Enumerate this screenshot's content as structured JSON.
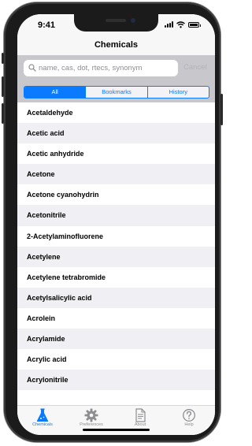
{
  "status": {
    "time": "9:41"
  },
  "nav": {
    "title": "Chemicals"
  },
  "search": {
    "placeholder": "name, cas, dot, rtecs, synonym",
    "cancel_label": "Cancel"
  },
  "filter": {
    "segments": [
      {
        "label": "All",
        "selected": true
      },
      {
        "label": "Bookmarks",
        "selected": false
      },
      {
        "label": "History",
        "selected": false
      }
    ]
  },
  "chemicals": [
    "Acetaldehyde",
    "Acetic acid",
    "Acetic anhydride",
    "Acetone",
    "Acetone cyanohydrin",
    "Acetonitrile",
    "2-Acetylaminofluorene",
    "Acetylene",
    "Acetylene tetrabromide",
    "Acetylsalicylic acid",
    "Acrolein",
    "Acrylamide",
    "Acrylic acid",
    "Acrylonitrile"
  ],
  "tabs": [
    {
      "label": "Chemicals",
      "icon": "flask-icon",
      "active": true
    },
    {
      "label": "Preferences",
      "icon": "gear-icon",
      "active": false
    },
    {
      "label": "About",
      "icon": "document-icon",
      "active": false
    },
    {
      "label": "Help",
      "icon": "question-icon",
      "active": false
    }
  ],
  "colors": {
    "accent": "#0a7aff",
    "row_alt": "#efeff4",
    "search_bar": "#c7c7cc"
  }
}
